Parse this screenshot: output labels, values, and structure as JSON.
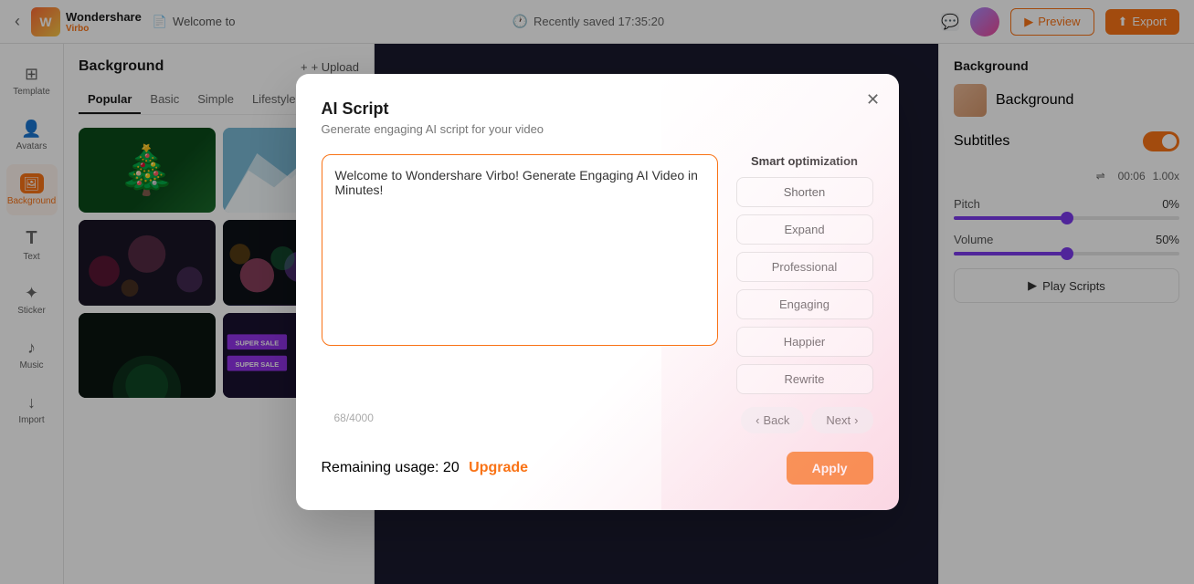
{
  "app": {
    "name": "Wondershare",
    "sub": "Virbo",
    "welcome_text": "Welcome to"
  },
  "topbar": {
    "saved_text": "Recently saved 17:35:20",
    "preview_label": "Preview",
    "export_label": "Export",
    "back_icon": "‹"
  },
  "sidebar": {
    "items": [
      {
        "id": "template",
        "label": "Template",
        "icon": "⊞"
      },
      {
        "id": "avatars",
        "label": "Avatars",
        "icon": "👤"
      },
      {
        "id": "background",
        "label": "Background",
        "icon": "🖼"
      },
      {
        "id": "text",
        "label": "Text",
        "icon": "T"
      },
      {
        "id": "sticker",
        "label": "Sticker",
        "icon": "★"
      },
      {
        "id": "music",
        "label": "Music",
        "icon": "♪"
      },
      {
        "id": "import",
        "label": "Import",
        "icon": "↓"
      }
    ],
    "active": "background"
  },
  "bg_panel": {
    "title": "Background",
    "upload_label": "+ Upload",
    "tabs": [
      "Popular",
      "Basic",
      "Simple",
      "Lifestyle"
    ],
    "active_tab": "Popular"
  },
  "right_panel": {
    "bg_section_title": "Background",
    "bg_item_label": "Background",
    "subtitles_label": "Subtitles",
    "subtitles_on": true,
    "pitch_label": "Pitch",
    "pitch_value": "0%",
    "pitch_fill": 0,
    "volume_label": "Volume",
    "volume_value": "50%",
    "volume_fill": 50,
    "time": "00:06",
    "speed": "1.00x",
    "play_scripts_label": "Play Scripts"
  },
  "modal": {
    "title": "AI Script",
    "subtitle": "Generate engaging AI script for your video",
    "script_text": "Welcome to Wondershare Virbo! Generate Engaging AI Video in Minutes!",
    "char_count": "68/4000",
    "smart_optimization_title": "Smart optimization",
    "optimization_buttons": [
      {
        "id": "shorten",
        "label": "Shorten"
      },
      {
        "id": "expand",
        "label": "Expand"
      },
      {
        "id": "professional",
        "label": "Professional"
      },
      {
        "id": "engaging",
        "label": "Engaging"
      },
      {
        "id": "happier",
        "label": "Happier"
      },
      {
        "id": "rewrite",
        "label": "Rewrite"
      }
    ],
    "back_label": "Back",
    "next_label": "Next",
    "remaining_text": "Remaining usage: 20",
    "upgrade_label": "Upgrade",
    "apply_label": "Apply"
  }
}
